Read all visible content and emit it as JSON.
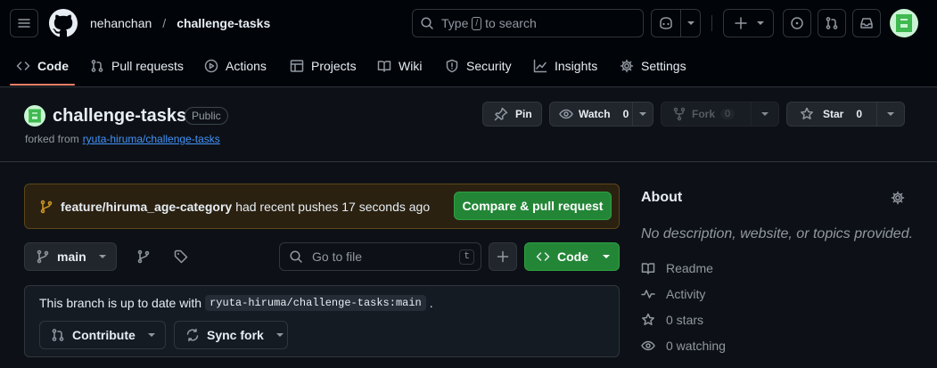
{
  "header": {
    "owner": "nehanchan",
    "separator": "/",
    "repo": "challenge-tasks",
    "search": {
      "prefix": "Type",
      "key": "/",
      "suffix": "to search"
    }
  },
  "nav": {
    "tabs": [
      {
        "label": "Code",
        "icon": "code-icon"
      },
      {
        "label": "Pull requests",
        "icon": "git-pull-request-icon"
      },
      {
        "label": "Actions",
        "icon": "play-icon"
      },
      {
        "label": "Projects",
        "icon": "table-icon"
      },
      {
        "label": "Wiki",
        "icon": "book-icon"
      },
      {
        "label": "Security",
        "icon": "shield-icon"
      },
      {
        "label": "Insights",
        "icon": "graph-icon"
      },
      {
        "label": "Settings",
        "icon": "gear-icon"
      }
    ]
  },
  "repo": {
    "name": "challenge-tasks",
    "visibility": "Public",
    "forked_prefix": "forked from",
    "forked_from": "ryuta-hiruma/challenge-tasks",
    "pin_label": "Pin",
    "watch_label": "Watch",
    "watch_count": "0",
    "fork_label": "Fork",
    "fork_count": "0",
    "star_label": "Star",
    "star_count": "0"
  },
  "banner": {
    "branch": "feature/hiruma_age-category",
    "message": "had recent pushes 17 seconds ago",
    "button": "Compare & pull request"
  },
  "filebar": {
    "branch": "main",
    "goto_placeholder": "Go to file",
    "goto_key": "t",
    "code_button": "Code"
  },
  "status": {
    "prefix": "This branch is up to date with",
    "ref": "ryuta-hiruma/challenge-tasks:main",
    "suffix": ".",
    "contribute": "Contribute",
    "sync": "Sync fork"
  },
  "about": {
    "title": "About",
    "description": "No description, website, or topics provided.",
    "items": [
      {
        "label": "Readme",
        "icon": "book-icon"
      },
      {
        "label": "Activity",
        "icon": "pulse-icon"
      },
      {
        "label": "0 stars",
        "icon": "star-icon"
      },
      {
        "label": "0 watching",
        "icon": "eye-icon"
      }
    ]
  },
  "colors": {
    "accent_green": "#238636",
    "link_blue": "#4493f8",
    "tab_underline": "#f78166",
    "banner_bg": "#2b2111",
    "banner_border": "#5c4618"
  }
}
